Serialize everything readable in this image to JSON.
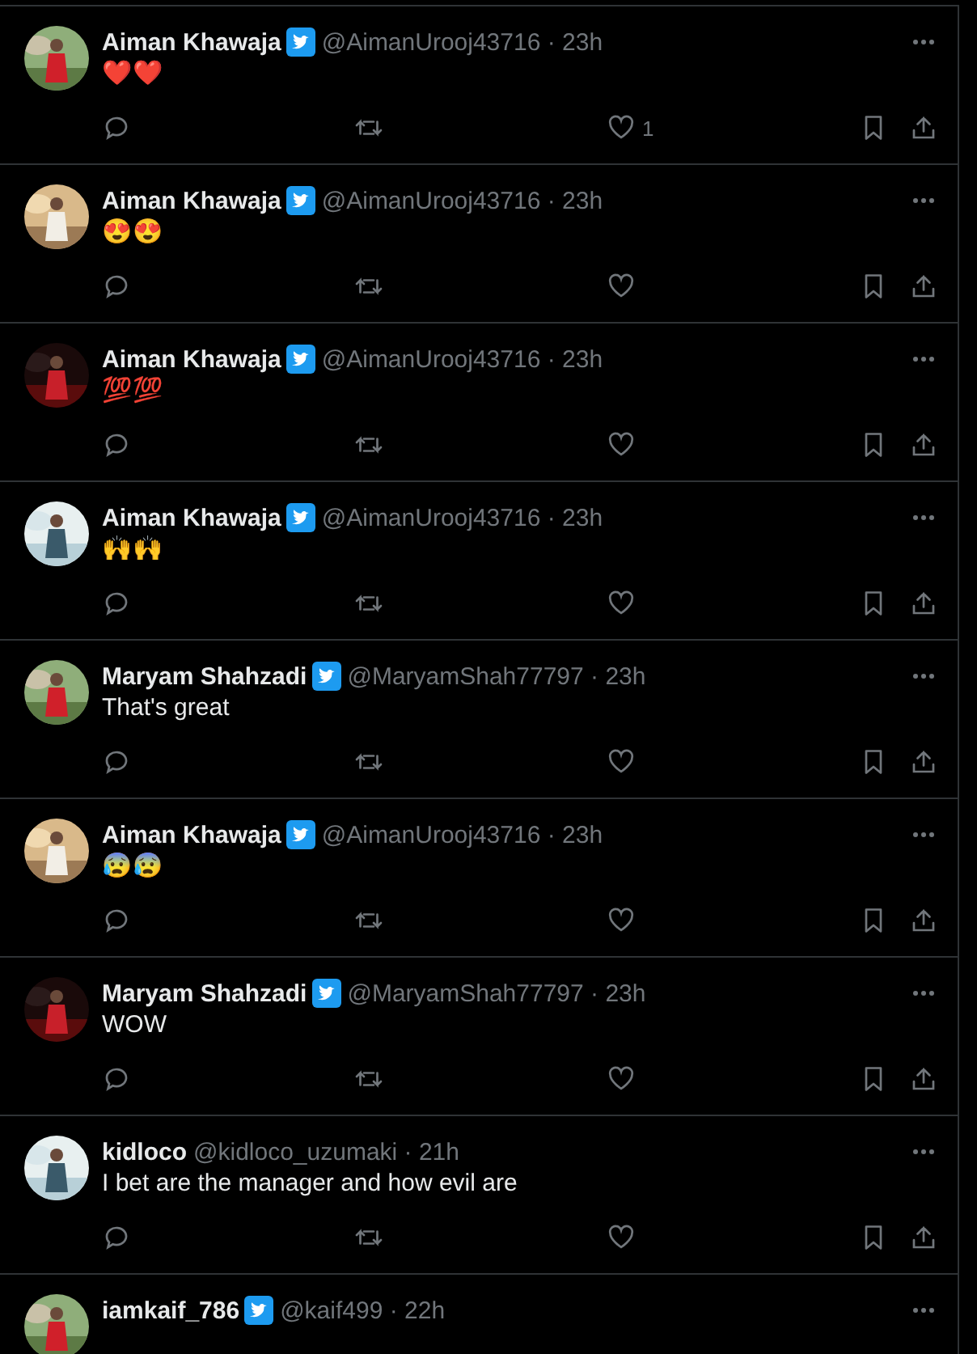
{
  "tweets": [
    {
      "name": "Aiman Khawaja",
      "verified": true,
      "meta": "@AimanUrooj43716 · 23h",
      "text": "❤️❤️",
      "likes": "1"
    },
    {
      "name": "Aiman Khawaja",
      "verified": true,
      "meta": "@AimanUrooj43716 · 23h",
      "text": "😍😍"
    },
    {
      "name": "Aiman Khawaja",
      "verified": true,
      "meta": "@AimanUrooj43716 · 23h",
      "text": "💯💯"
    },
    {
      "name": "Aiman Khawaja",
      "verified": true,
      "meta": "@AimanUrooj43716 · 23h",
      "text": "🙌🙌"
    },
    {
      "name": "Maryam Shahzadi",
      "verified": true,
      "meta": "@MaryamShah77797 · 23h",
      "text": "That's great"
    },
    {
      "name": "Aiman Khawaja",
      "verified": true,
      "meta": "@AimanUrooj43716 · 23h",
      "text": "😰😰"
    },
    {
      "name": "Maryam Shahzadi",
      "verified": true,
      "meta": "@MaryamShah77797 · 23h",
      "text": "WOW"
    },
    {
      "name": "kidloco",
      "verified": false,
      "meta": "@kidloco_uzumaki · 21h",
      "text": "I bet are the manager and how evil are"
    },
    {
      "name": "iamkaif_786",
      "verified": true,
      "meta": "@kaif499 · 22h"
    }
  ]
}
